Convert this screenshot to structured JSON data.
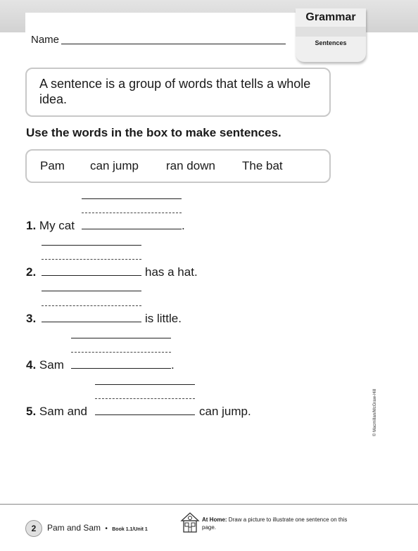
{
  "header": {
    "name_label": "Name",
    "tab_title": "Grammar",
    "tab_subtitle": "Sentences"
  },
  "definition": "A sentence is a group of words that tells a whole idea.",
  "instruction": "Use the words in the box to make sentences.",
  "word_bank": [
    "Pam",
    "can jump",
    "ran down",
    "The bat"
  ],
  "items": [
    {
      "number": "1.",
      "before": "My cat",
      "after": "."
    },
    {
      "number": "2.",
      "before": "",
      "after": "has a hat."
    },
    {
      "number": "3.",
      "before": "",
      "after": "is little."
    },
    {
      "number": "4.",
      "before": "Sam",
      "after": "."
    },
    {
      "number": "5.",
      "before": "Sam and",
      "after": "can jump."
    }
  ],
  "copyright": "© Macmillan/McGraw-Hill",
  "footer": {
    "page_number": "2",
    "title": "Pam and Sam",
    "bullet": "•",
    "book": "Book 1.1/Unit 1",
    "at_home_label": "At Home:",
    "at_home_text": "Draw a picture to illustrate one sentence on this page."
  }
}
